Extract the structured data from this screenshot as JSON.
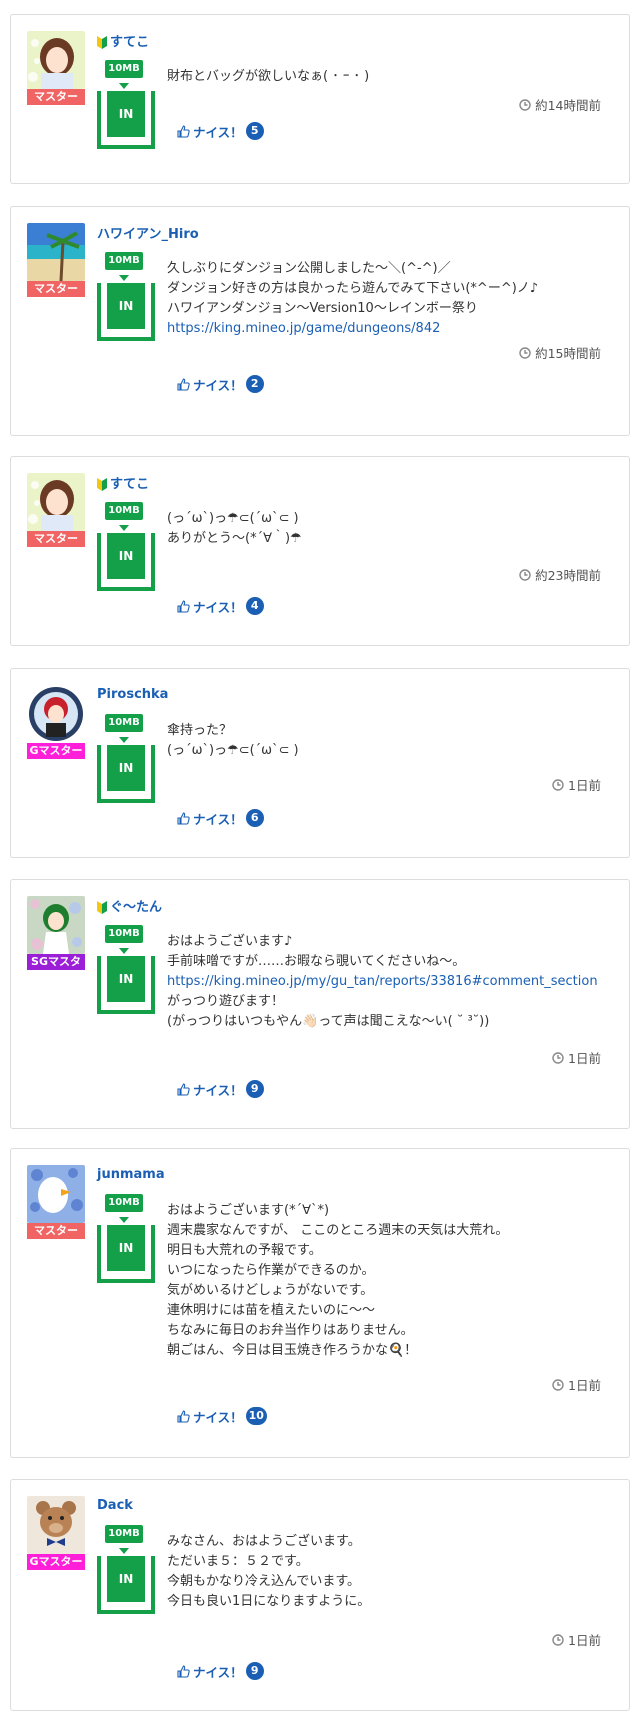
{
  "posts": [
    {
      "name": "すてこ",
      "beginner": true,
      "role": "マスター",
      "role_color": "#f06464",
      "mb": "10MB",
      "in_label": "IN",
      "lines": [
        "財布とバッグが欲しいなぁ( ･ ｰ ･ )"
      ],
      "time": "約14時間前",
      "nice_label": "ナイス！",
      "nice_count": "5"
    },
    {
      "name": "ハワイアン_Hiro",
      "beginner": false,
      "role": "マスター",
      "role_color": "#f06464",
      "mb": "10MB",
      "in_label": "IN",
      "lines": [
        "久しぶりにダンジョン公開しました〜＼(^-^)／",
        "ダンジョン好きの方は良かったら遊んでみて下さい(*^ー^)ノ♪",
        "ハワイアンダンジョン〜Version10〜レインボー祭り"
      ],
      "link": "https://king.mineo.jp/game/dungeons/842",
      "time": "約15時間前",
      "nice_label": "ナイス！",
      "nice_count": "2"
    },
    {
      "name": "すてこ",
      "beginner": true,
      "role": "マスター",
      "role_color": "#f06464",
      "mb": "10MB",
      "in_label": "IN",
      "lines": [
        "(っ´ω`)っ☂⊂(´ω`⊂ )",
        "ありがとう〜(*´∀｀)☂"
      ],
      "time": "約23時間前",
      "nice_label": "ナイス！",
      "nice_count": "4"
    },
    {
      "name": "Piroschka",
      "beginner": false,
      "role": "Gマスター",
      "role_color": "#ff1fd8",
      "mb": "10MB",
      "in_label": "IN",
      "lines": [
        "傘持った？",
        "(っ´ω`)っ☂⊂(´ω`⊂ )"
      ],
      "time": "1日前",
      "nice_label": "ナイス！",
      "nice_count": "6"
    },
    {
      "name": "ぐ〜たん",
      "beginner": true,
      "role": "SGマスタ",
      "role_color": "#9b1fd6",
      "mb": "10MB",
      "in_label": "IN",
      "lines": [
        "おはようございます♪",
        "手前味噌ですが……お暇なら覗いてくださいね〜。"
      ],
      "link": "https://king.mineo.jp/my/gu_tan/reports/33816#comment_section",
      "lines_after": [
        "がっつり遊びます！",
        "(がっつりはいつもやん👋🏻って声は聞こえな〜い( ˘ ³˘))"
      ],
      "time": "1日前",
      "nice_label": "ナイス！",
      "nice_count": "9"
    },
    {
      "name": "junmama",
      "beginner": false,
      "role": "マスター",
      "role_color": "#f06464",
      "mb": "10MB",
      "in_label": "IN",
      "lines": [
        "おはようございます(*´∀`*)",
        "週末農家なんですが、 ここのところ週末の天気は大荒れ。",
        "明日も大荒れの予報です。",
        "いつになったら作業ができるのか。",
        "気がめいるけどしょうがないです。",
        "連休明けには苗を植えたいのに〜〜",
        "ちなみに毎日のお弁当作りはありません。",
        "朝ごはん、今日は目玉焼き作ろうかな🍳！"
      ],
      "time": "1日前",
      "nice_label": "ナイス！",
      "nice_count": "10"
    },
    {
      "name": "Dack",
      "beginner": false,
      "role": "Gマスター",
      "role_color": "#ff1fd8",
      "mb": "10MB",
      "in_label": "IN",
      "lines": [
        "みなさん、おはようございます。",
        "ただいま５：５２です。",
        "今朝もかなり冷え込んでいます。",
        "今日も良い1日になりますように。"
      ],
      "time": "1日前",
      "nice_label": "ナイス！",
      "nice_count": "9"
    }
  ]
}
